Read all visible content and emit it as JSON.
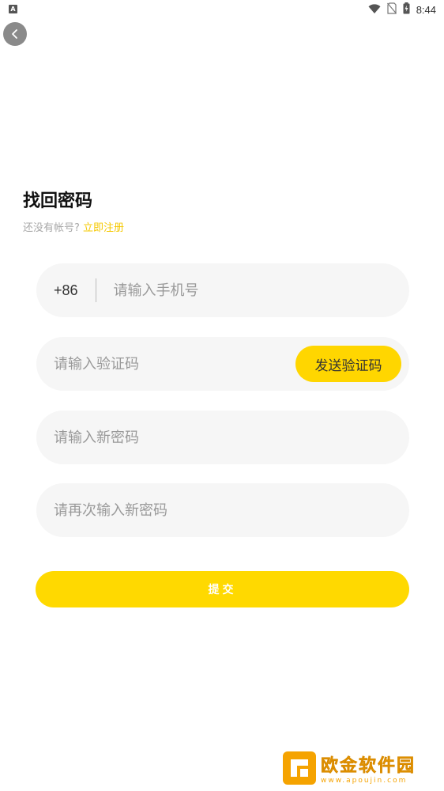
{
  "status_bar": {
    "left_icon": "A",
    "time": "8:44",
    "icons": [
      "wifi-icon",
      "no-sim-icon",
      "battery-charging-icon"
    ]
  },
  "header": {
    "back_icon": "chevron-left-icon"
  },
  "title": "找回密码",
  "subtitle": {
    "prompt": "还没有帐号?",
    "register_link": "立即注册"
  },
  "form": {
    "country_code": "+86",
    "phone_placeholder": "请输入手机号",
    "code_placeholder": "请输入验证码",
    "send_code_label": "发送验证码",
    "new_password_placeholder": "请输入新密码",
    "confirm_password_placeholder": "请再次输入新密码",
    "submit_label": "提交"
  },
  "watermark": {
    "title": "欧金软件园",
    "url": "www.apoujin.com"
  },
  "colors": {
    "accent": "#ffd600",
    "link": "#f5c800",
    "field_bg": "#f6f6f6",
    "watermark": "#f5a300"
  }
}
